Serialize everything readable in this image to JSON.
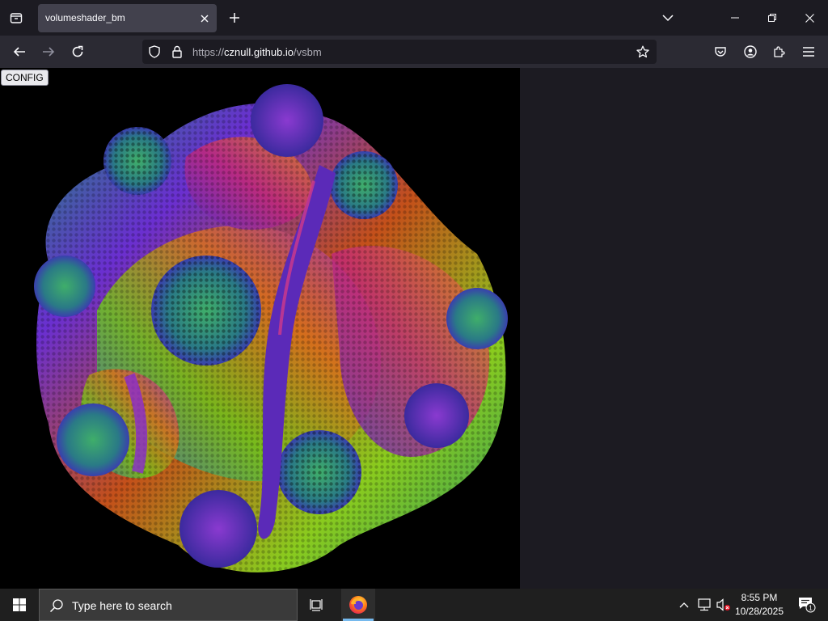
{
  "browser": {
    "tab_title": "volumeshader_bm",
    "url_prefix": "https://",
    "url_host": "cznull.github.io",
    "url_path": "/vsbm"
  },
  "page": {
    "config_label": "CONFIG",
    "canvas_background": "#000000"
  },
  "taskbar": {
    "search_placeholder": "Type here to search",
    "time": "8:55 PM",
    "date": "10/28/2025",
    "notification_count": "1"
  },
  "icons": {
    "tab_list": "tab-list-icon",
    "close": "close-icon",
    "plus": "plus-icon",
    "back": "arrow-left-icon",
    "forward": "arrow-right-icon",
    "reload": "reload-icon",
    "shield": "shield-icon",
    "lock": "lock-icon",
    "star": "star-icon",
    "pocket": "pocket-icon",
    "account": "account-icon",
    "extensions": "puzzle-icon",
    "menu": "hamburger-icon",
    "windows": "windows-logo-icon",
    "search": "search-icon",
    "task_view": "task-view-icon",
    "firefox": "firefox-icon"
  },
  "colors": {
    "tabstrip": "#1c1b22",
    "active_tab": "#42414d",
    "toolbar": "#2b2a33",
    "taskbar": "#1f1f1f",
    "taskbar_accent": "#76b9ed"
  }
}
